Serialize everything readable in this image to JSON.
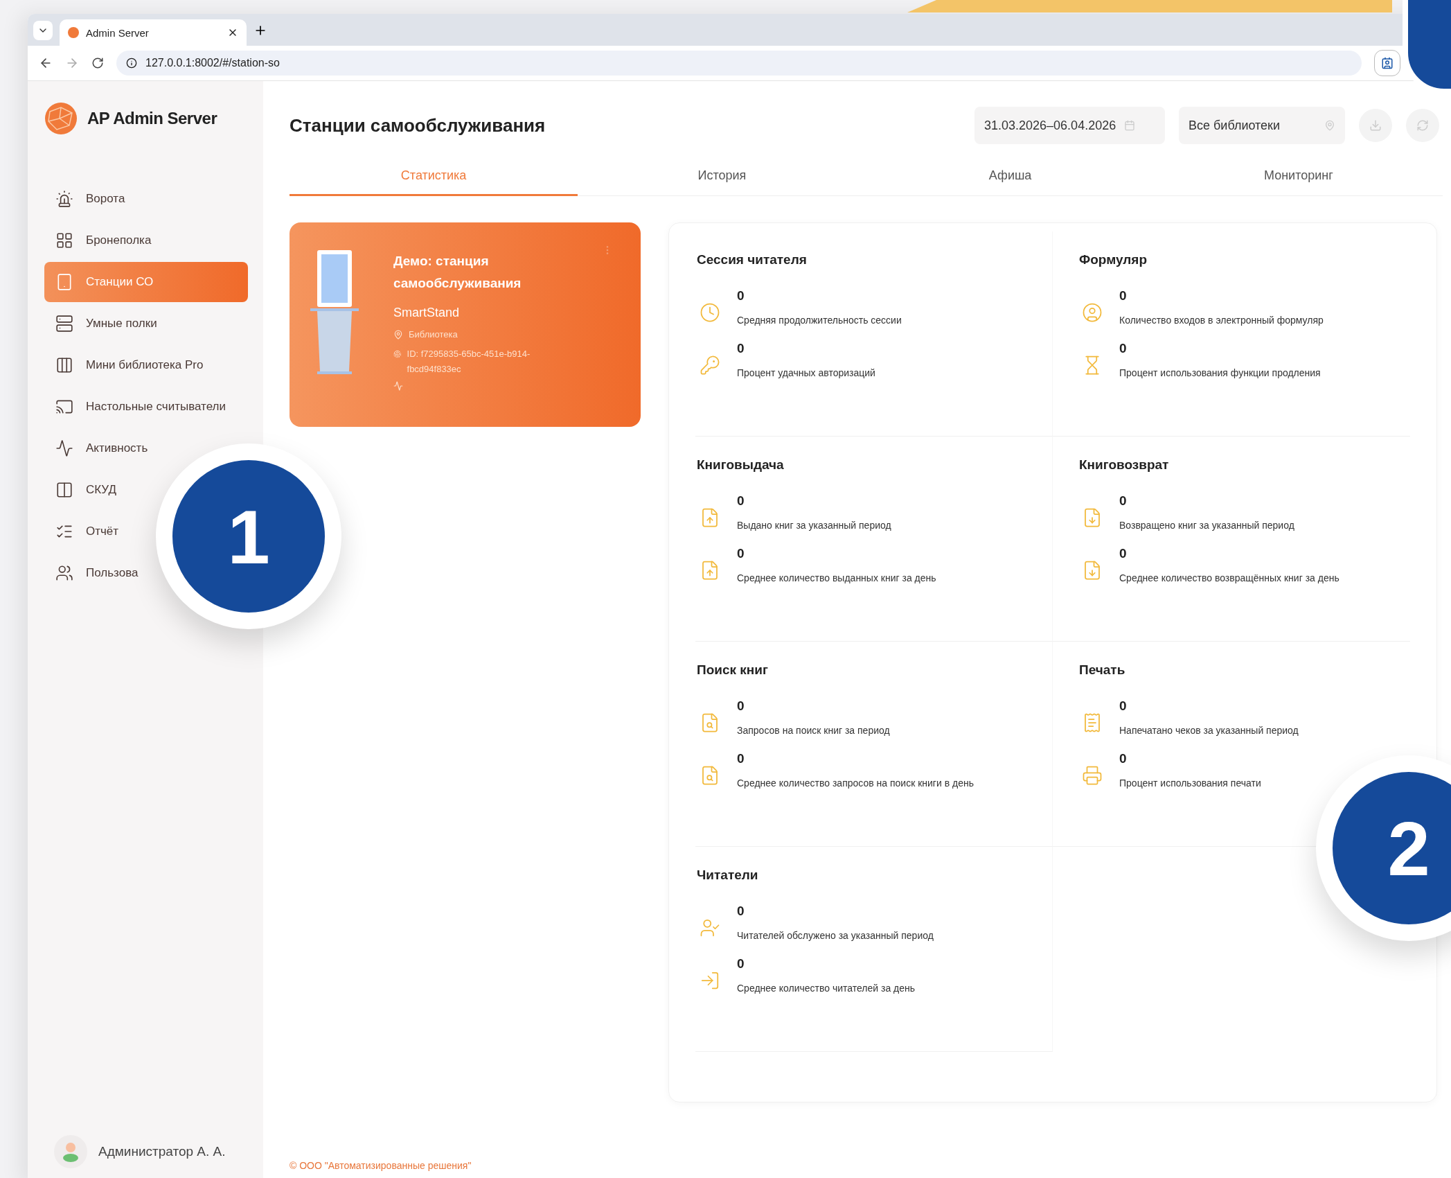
{
  "browser": {
    "tab_title": "Admin Server",
    "url": "127.0.0.1:8002/#/station-so"
  },
  "sidebar": {
    "logo_title": "AP Admin Server",
    "items": [
      {
        "label": "Ворота",
        "selected": false
      },
      {
        "label": "Бронеполка",
        "selected": false
      },
      {
        "label": "Станции СО",
        "selected": true
      },
      {
        "label": "Умные полки",
        "selected": false
      },
      {
        "label": "Мини библиотека Pro",
        "selected": false
      },
      {
        "label": "Настольные считыватели",
        "selected": false
      },
      {
        "label": "Активность",
        "selected": false
      },
      {
        "label": "СКУД",
        "selected": false
      },
      {
        "label": "Отчёт",
        "selected": false
      },
      {
        "label": "Пользова",
        "selected": false
      }
    ],
    "user": "Администратор А. А."
  },
  "header": {
    "title": "Станции самообслуживания",
    "date_range": "31.03.2026–06.04.2026",
    "library": "Все библиотеки"
  },
  "tabs": [
    {
      "label": "Статистика",
      "selected": true
    },
    {
      "label": "История",
      "selected": false
    },
    {
      "label": "Афиша",
      "selected": false
    },
    {
      "label": "Мониторинг",
      "selected": false
    }
  ],
  "station": {
    "name": "Демо: станция самообслуживания",
    "model": "SmartStand",
    "location": "Библиотека",
    "id": "ID: f7295835-65bc-451e-b914-fbcd94f833ec"
  },
  "sections": [
    {
      "title": "Сессия читателя",
      "metrics": [
        {
          "value": "0",
          "label": "Средняя продолжительность сессии"
        },
        {
          "value": "0",
          "label": "Процент удачных авторизаций"
        }
      ]
    },
    {
      "title": "Формуляр",
      "metrics": [
        {
          "value": "0",
          "label": "Количество входов в электронный формуляр"
        },
        {
          "value": "0",
          "label": "Процент использования функции продления"
        }
      ]
    },
    {
      "title": "Книговыдача",
      "metrics": [
        {
          "value": "0",
          "label": "Выдано книг за указанный период"
        },
        {
          "value": "0",
          "label": "Среднее количество выданных книг за день"
        }
      ]
    },
    {
      "title": "Книговозврат",
      "metrics": [
        {
          "value": "0",
          "label": "Возвращено книг за указанный период"
        },
        {
          "value": "0",
          "label": "Среднее количество возвращённых книг за день"
        }
      ]
    },
    {
      "title": "Поиск книг",
      "metrics": [
        {
          "value": "0",
          "label": "Запросов на поиск книг за период"
        },
        {
          "value": "0",
          "label": "Среднее количество запросов на поиск книги в день"
        }
      ]
    },
    {
      "title": "Печать",
      "metrics": [
        {
          "value": "0",
          "label": "Напечатано чеков за указанный период"
        },
        {
          "value": "0",
          "label": "Процент использования печати"
        }
      ]
    },
    {
      "title": "Читатели",
      "metrics": [
        {
          "value": "0",
          "label": "Читателей обслужено за указанный период"
        },
        {
          "value": "0",
          "label": "Среднее количество читателей за день"
        }
      ]
    }
  ],
  "footer": "© ООО \"Автоматизированные решения\"",
  "callouts": [
    "1",
    "2"
  ]
}
